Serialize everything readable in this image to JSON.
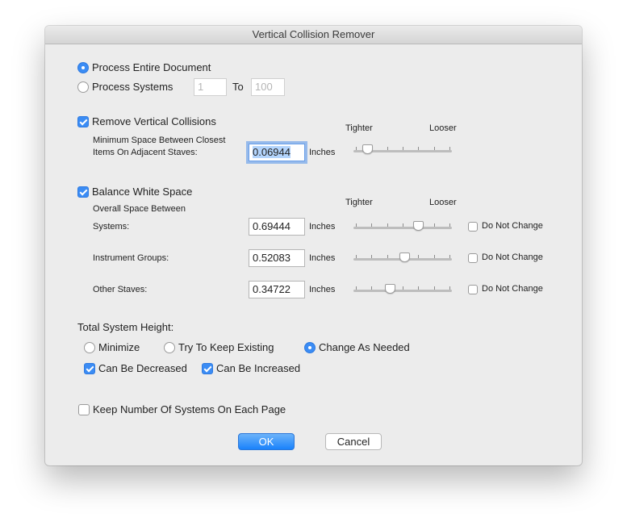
{
  "window": {
    "title": "Vertical Collision Remover"
  },
  "range": {
    "process_entire_label": "Process Entire Document",
    "process_systems_label": "Process Systems",
    "from_value": "1",
    "to_label": "To",
    "to_value": "100",
    "selected": "process_entire"
  },
  "vertical": {
    "remove_label": "Remove Vertical Collisions",
    "remove_checked": true,
    "min_space_line1": "Minimum Space Between Closest",
    "min_space_line2": "Items On Adjacent Staves:",
    "min_space_value": "0.06944",
    "units": "Inches",
    "tighter_label": "Tighter",
    "looser_label": "Looser",
    "slider_level": 0.1
  },
  "white_space": {
    "balance_label": "Balance White Space",
    "balance_checked": true,
    "overall_label": "Overall Space Between",
    "tighter_label": "Tighter",
    "looser_label": "Looser",
    "rows": [
      {
        "label": "Systems:",
        "value": "0.69444",
        "units": "Inches",
        "slider_level": 0.68,
        "do_not_change_label": "Do Not Change",
        "do_not_change": false
      },
      {
        "label": "Instrument Groups:",
        "value": "0.52083",
        "units": "Inches",
        "slider_level": 0.52,
        "do_not_change_label": "Do Not Change",
        "do_not_change": false
      },
      {
        "label": "Other Staves:",
        "value": "0.34722",
        "units": "Inches",
        "slider_level": 0.36,
        "do_not_change_label": "Do Not Change",
        "do_not_change": false
      }
    ]
  },
  "height": {
    "title": "Total System Height:",
    "minimize_label": "Minimize",
    "try_keep_label": "Try To Keep Existing",
    "change_needed_label": "Change As Needed",
    "selected": "change_as_needed",
    "can_decrease_label": "Can Be Decreased",
    "can_decrease": true,
    "can_increase_label": "Can Be Increased",
    "can_increase": true
  },
  "keep_systems": {
    "label": "Keep Number Of Systems On Each Page",
    "checked": false
  },
  "buttons": {
    "ok": "OK",
    "cancel": "Cancel"
  },
  "colors": {
    "accent": "#3b8cf4",
    "ok_button": "#1a82fb",
    "window_bg": "#ececec"
  }
}
